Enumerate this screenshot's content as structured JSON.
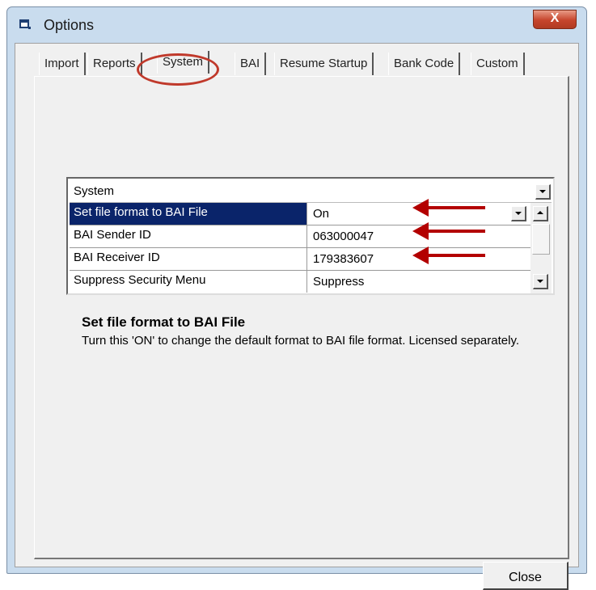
{
  "window": {
    "title": "Options",
    "close_glyph": "X",
    "icon": "options-window-icon"
  },
  "tabs": [
    {
      "label": "Import"
    },
    {
      "label": "Reports"
    },
    {
      "label": "System"
    },
    {
      "label": "BAI"
    },
    {
      "label": "Resume Startup"
    },
    {
      "label": "Bank Code"
    },
    {
      "label": "Custom"
    }
  ],
  "active_tab": "System",
  "grid": {
    "category": "System",
    "rows": [
      {
        "name": "Set file format to BAI File",
        "value": "On"
      },
      {
        "name": "BAI Sender ID",
        "value": "063000047"
      },
      {
        "name": "BAI Receiver ID",
        "value": "179383607"
      },
      {
        "name": "Suppress Security Menu",
        "value": "Suppress"
      }
    ]
  },
  "description": {
    "title": "Set file format to BAI File",
    "text": "Turn this 'ON' to change the default format to BAI file format. Licensed separately."
  },
  "buttons": {
    "close": "Close"
  },
  "colors": {
    "selection": "#0a246a",
    "annotation": "#b30000",
    "highlight_ring": "#c0392b"
  }
}
